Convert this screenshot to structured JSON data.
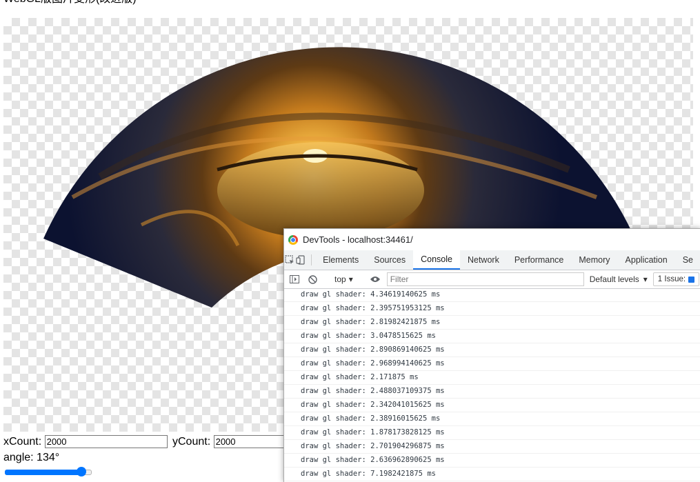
{
  "page": {
    "title": "WebGL版图片变形(改进版)"
  },
  "controls": {
    "xcount_label": "xCount:",
    "xcount_value": "2000",
    "ycount_label": "yCount:",
    "ycount_value": "2000",
    "angle_label": "angle: 134°",
    "angle_slider_fraction": 0.93
  },
  "devtools": {
    "title": "DevTools - localhost:34461/",
    "tabs": [
      "Elements",
      "Sources",
      "Console",
      "Network",
      "Performance",
      "Memory",
      "Application",
      "Se"
    ],
    "active_tab": "Console",
    "context": "top",
    "filter_placeholder": "Filter",
    "levels": "Default levels",
    "issues": "1 Issue:",
    "log": [
      "draw gl shader: 4.34619140625 ms",
      "draw gl shader: 2.395751953125 ms",
      "draw gl shader: 2.81982421875 ms",
      "draw gl shader: 3.0478515625 ms",
      "draw gl shader: 2.890869140625 ms",
      "draw gl shader: 2.968994140625 ms",
      "draw gl shader: 2.171875 ms",
      "draw gl shader: 2.488037109375 ms",
      "draw gl shader: 2.342041015625 ms",
      "draw gl shader: 2.38916015625 ms",
      "draw gl shader: 1.878173828125 ms",
      "draw gl shader: 2.701904296875 ms",
      "draw gl shader: 2.636962890625 ms",
      "draw gl shader: 7.1982421875 ms"
    ]
  },
  "colors": {
    "accent": "#0075ff",
    "devtools_active": "#1a73e8"
  }
}
